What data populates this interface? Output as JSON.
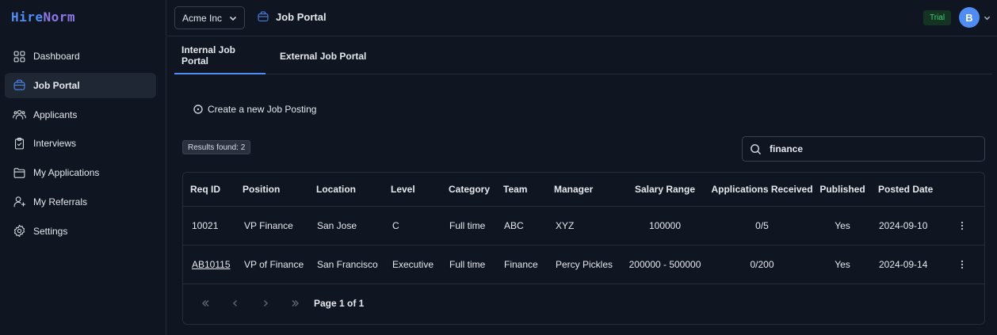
{
  "app": {
    "logo_part1": "Hire",
    "logo_part2": "Norm"
  },
  "sidebar": {
    "items": [
      {
        "label": "Dashboard",
        "icon": "grid-icon"
      },
      {
        "label": "Job Portal",
        "icon": "briefcase-icon",
        "active": true
      },
      {
        "label": "Applicants",
        "icon": "users-icon"
      },
      {
        "label": "Interviews",
        "icon": "clipboard-check-icon"
      },
      {
        "label": "My Applications",
        "icon": "folder-icon"
      },
      {
        "label": "My Referrals",
        "icon": "user-plus-icon"
      },
      {
        "label": "Settings",
        "icon": "gear-icon"
      }
    ]
  },
  "header": {
    "org": "Acme Inc",
    "title": "Job Portal",
    "trial": "Trial",
    "avatar_initial": "B"
  },
  "tabs": [
    {
      "label": "Internal Job Portal",
      "active": true
    },
    {
      "label": "External Job Portal",
      "active": false
    }
  ],
  "actions": {
    "create": "Create a new Job Posting"
  },
  "results": {
    "label": "Results found: 2"
  },
  "search": {
    "value": "finance",
    "placeholder": ""
  },
  "table": {
    "columns": [
      "Req ID",
      "Position",
      "Location",
      "Level",
      "Category",
      "Team",
      "Manager",
      "Salary Range",
      "Applications Received",
      "Published",
      "Posted Date"
    ],
    "rows": [
      [
        "10021",
        "VP Finance",
        "San Jose",
        "C",
        "Full time",
        "ABC",
        "XYZ",
        "100000",
        "0/5",
        "Yes",
        "2024-09-10"
      ],
      [
        "AB10115",
        "VP of Finance",
        "San Francisco",
        "Executive",
        "Full time",
        "Finance",
        "Percy Pickles",
        "200000 - 500000",
        "0/200",
        "Yes",
        "2024-09-14"
      ]
    ]
  },
  "pagination": {
    "label": "Page 1 of 1"
  },
  "colors": {
    "accent": "#4f8df5",
    "background": "#0f1521",
    "trial_text": "#3fcf78"
  }
}
